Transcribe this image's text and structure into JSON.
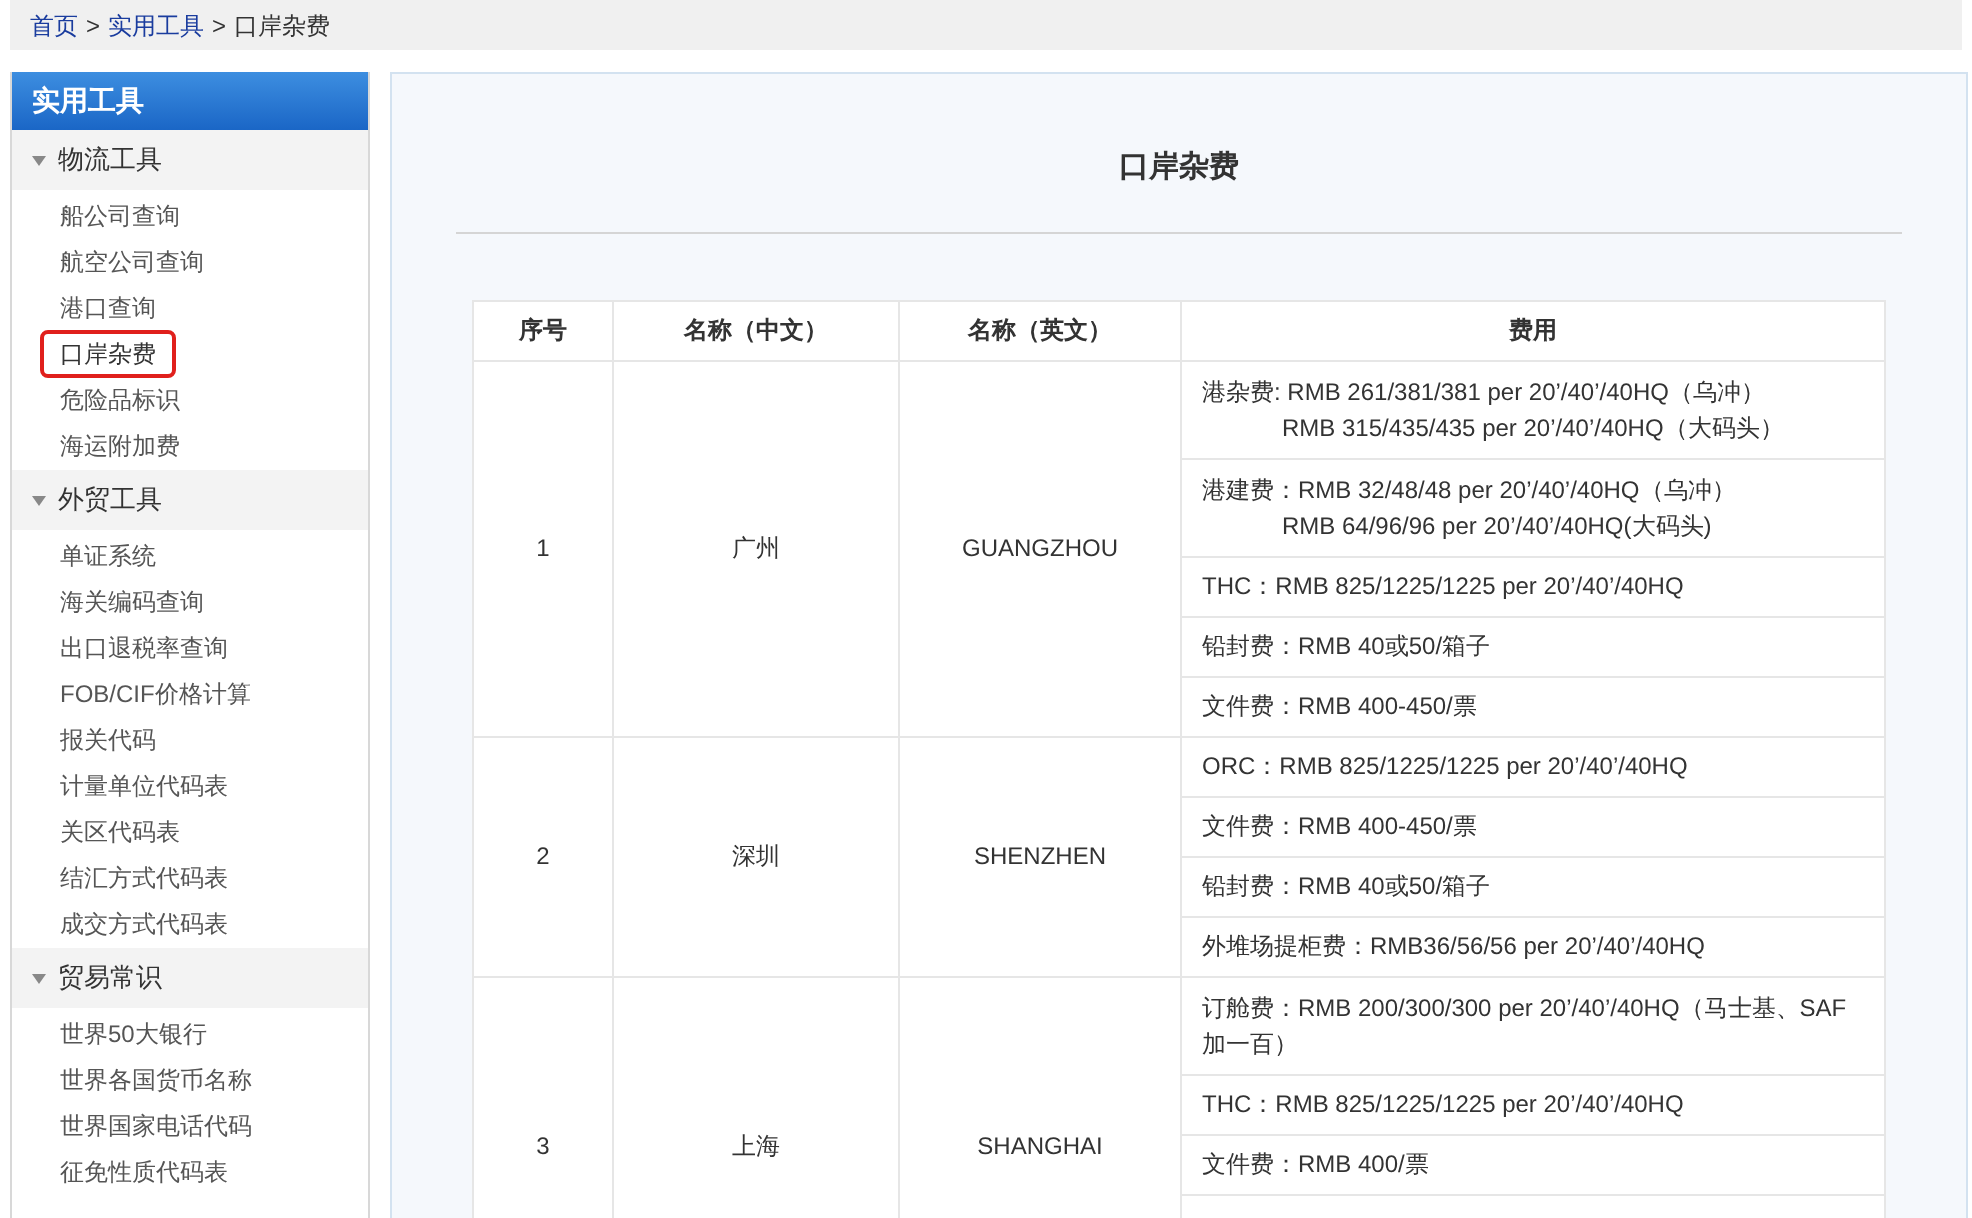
{
  "breadcrumb": [
    {
      "label": "首页",
      "link": true
    },
    {
      "label": "实用工具",
      "link": true
    },
    {
      "label": "口岸杂费",
      "link": false
    }
  ],
  "breadcrumb_separator": ">",
  "sidebar": {
    "title": "实用工具",
    "sections": [
      {
        "label": "物流工具",
        "expanded": true,
        "items": [
          {
            "label": "船公司查询",
            "selected": false
          },
          {
            "label": "航空公司查询",
            "selected": false
          },
          {
            "label": "港口查询",
            "selected": false
          },
          {
            "label": "口岸杂费",
            "selected": true
          },
          {
            "label": "危险品标识",
            "selected": false
          },
          {
            "label": "海运附加费",
            "selected": false
          }
        ]
      },
      {
        "label": "外贸工具",
        "expanded": true,
        "items": [
          {
            "label": "单证系统",
            "selected": false
          },
          {
            "label": "海关编码查询",
            "selected": false
          },
          {
            "label": "出口退税率查询",
            "selected": false
          },
          {
            "label": "FOB/CIF价格计算",
            "selected": false
          },
          {
            "label": "报关代码",
            "selected": false
          },
          {
            "label": "计量单位代码表",
            "selected": false
          },
          {
            "label": "关区代码表",
            "selected": false
          },
          {
            "label": "结汇方式代码表",
            "selected": false
          },
          {
            "label": "成交方式代码表",
            "selected": false
          }
        ]
      },
      {
        "label": "贸易常识",
        "expanded": true,
        "items": [
          {
            "label": "世界50大银行",
            "selected": false
          },
          {
            "label": "世界各国货币名称",
            "selected": false
          },
          {
            "label": "世界国家电话代码",
            "selected": false
          },
          {
            "label": "征免性质代码表",
            "selected": false
          }
        ]
      }
    ]
  },
  "content": {
    "title": "口岸杂费",
    "table": {
      "columns": [
        "序号",
        "名称（中文）",
        "名称（英文）",
        "费用"
      ],
      "rows": [
        {
          "index": "1",
          "name_cn": "广州",
          "name_en": "GUANGZHOU",
          "fees": [
            {
              "lines": [
                "港杂费: RMB 261/381/381 per 20’/40’/40HQ（乌冲）",
                "RMB 315/435/435 per 20’/40’/40HQ（大码头）"
              ]
            },
            {
              "lines": [
                "港建费：RMB 32/48/48 per 20’/40’/40HQ（乌冲）",
                "RMB 64/96/96 per 20’/40’/40HQ(大码头)"
              ]
            },
            {
              "lines": [
                "THC：RMB 825/1225/1225 per 20’/40’/40HQ"
              ]
            },
            {
              "lines": [
                "铅封费：RMB 40或50/箱子"
              ]
            },
            {
              "lines": [
                "文件费：RMB 400-450/票"
              ]
            }
          ]
        },
        {
          "index": "2",
          "name_cn": "深圳",
          "name_en": "SHENZHEN",
          "fees": [
            {
              "lines": [
                "ORC：RMB 825/1225/1225 per 20’/40’/40HQ"
              ]
            },
            {
              "lines": [
                "文件费：RMB 400-450/票"
              ]
            },
            {
              "lines": [
                "铅封费：RMB 40或50/箱子"
              ]
            },
            {
              "lines": [
                "外堆场提柜费：RMB36/56/56 per 20’/40’/40HQ"
              ]
            }
          ]
        },
        {
          "index": "3",
          "name_cn": "上海",
          "name_en": "SHANGHAI",
          "fees": [
            {
              "lines": [
                "订舱费：RMB 200/300/300 per 20’/40’/40HQ（马士基、SAF加一百）"
              ]
            },
            {
              "lines": [
                "THC：RMB 825/1225/1225 per 20’/40’/40HQ"
              ]
            },
            {
              "lines": [
                "文件费：RMB 400/票"
              ]
            }
          ]
        }
      ]
    }
  }
}
